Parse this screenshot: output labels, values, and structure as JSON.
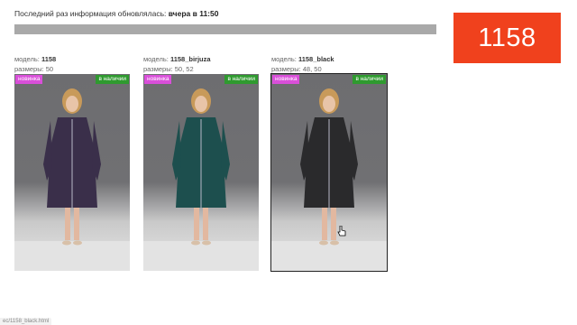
{
  "header": {
    "update_prefix": "Последний раз информация обновлялась:",
    "update_value": "вчера в 11:50"
  },
  "counter": {
    "value": "1158",
    "color": "#f0411d"
  },
  "labels": {
    "model": "модель:",
    "sizes": "размеры:",
    "new_tag": "новинка",
    "stock_tag": "в наличии"
  },
  "products": [
    {
      "model": "1158",
      "sizes": "50",
      "coat_color": "#3a2f4a"
    },
    {
      "model": "1158_birjuza",
      "sizes": "50, 52",
      "coat_color": "#1d4f4e"
    },
    {
      "model": "1158_black",
      "sizes": "48, 50",
      "coat_color": "#2a2a2c"
    }
  ],
  "status_bar": {
    "url": "ec/1158_black.html"
  }
}
